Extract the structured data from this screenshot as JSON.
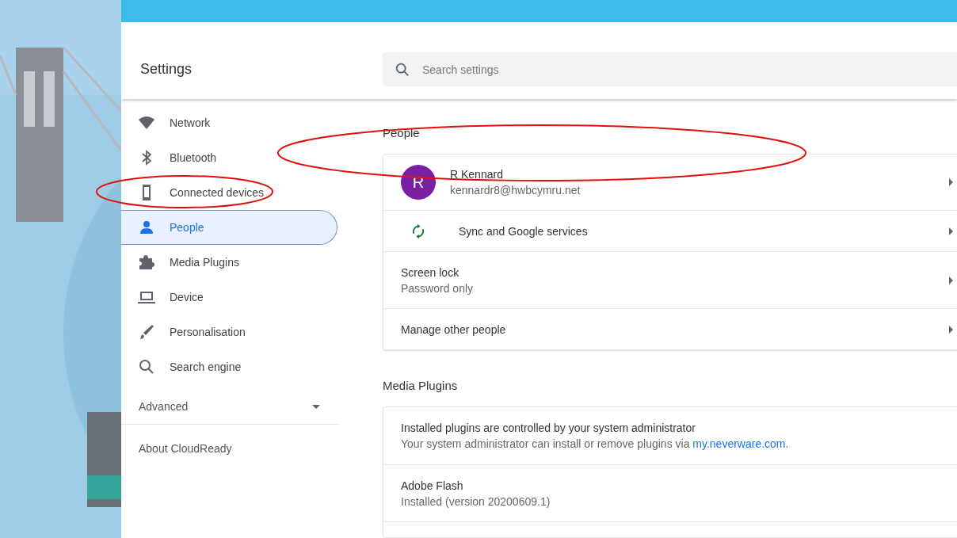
{
  "window": {
    "title": "Settings"
  },
  "search": {
    "placeholder": "Search settings"
  },
  "sidebar": {
    "items": [
      {
        "label": "Network",
        "kind": "wifi",
        "selected": false
      },
      {
        "label": "Bluetooth",
        "kind": "bluetooth",
        "selected": false
      },
      {
        "label": "Connected devices",
        "kind": "phone",
        "selected": false
      },
      {
        "label": "People",
        "kind": "person",
        "selected": true
      },
      {
        "label": "Media Plugins",
        "kind": "puzzle",
        "selected": false
      },
      {
        "label": "Device",
        "kind": "laptop",
        "selected": false
      },
      {
        "label": "Personalisation",
        "kind": "brush",
        "selected": false
      },
      {
        "label": "Search engine",
        "kind": "search",
        "selected": false
      }
    ],
    "advanced": {
      "label": "Advanced",
      "expanded": false
    },
    "about": "About CloudReady"
  },
  "people": {
    "heading": "People",
    "account": {
      "initial": "R",
      "name": "R Kennard",
      "email": "kennardr8@hwbcymru.net"
    },
    "rows": [
      {
        "kind": "sync",
        "title": "Sync and Google services"
      },
      {
        "kind": "plain",
        "title": "Screen lock",
        "subtitle": "Password only"
      },
      {
        "kind": "plain",
        "title": "Manage other people"
      }
    ]
  },
  "media_plugins": {
    "heading": "Media Plugins",
    "notice": {
      "title": "Installed plugins are controlled by your system administrator",
      "text": "Your system administrator can install or remove plugins via ",
      "link": "my.neverware.com",
      "after": "."
    },
    "plugins": [
      {
        "name": "Adobe Flash",
        "status": "Installed (version 20200609.1)"
      }
    ]
  }
}
